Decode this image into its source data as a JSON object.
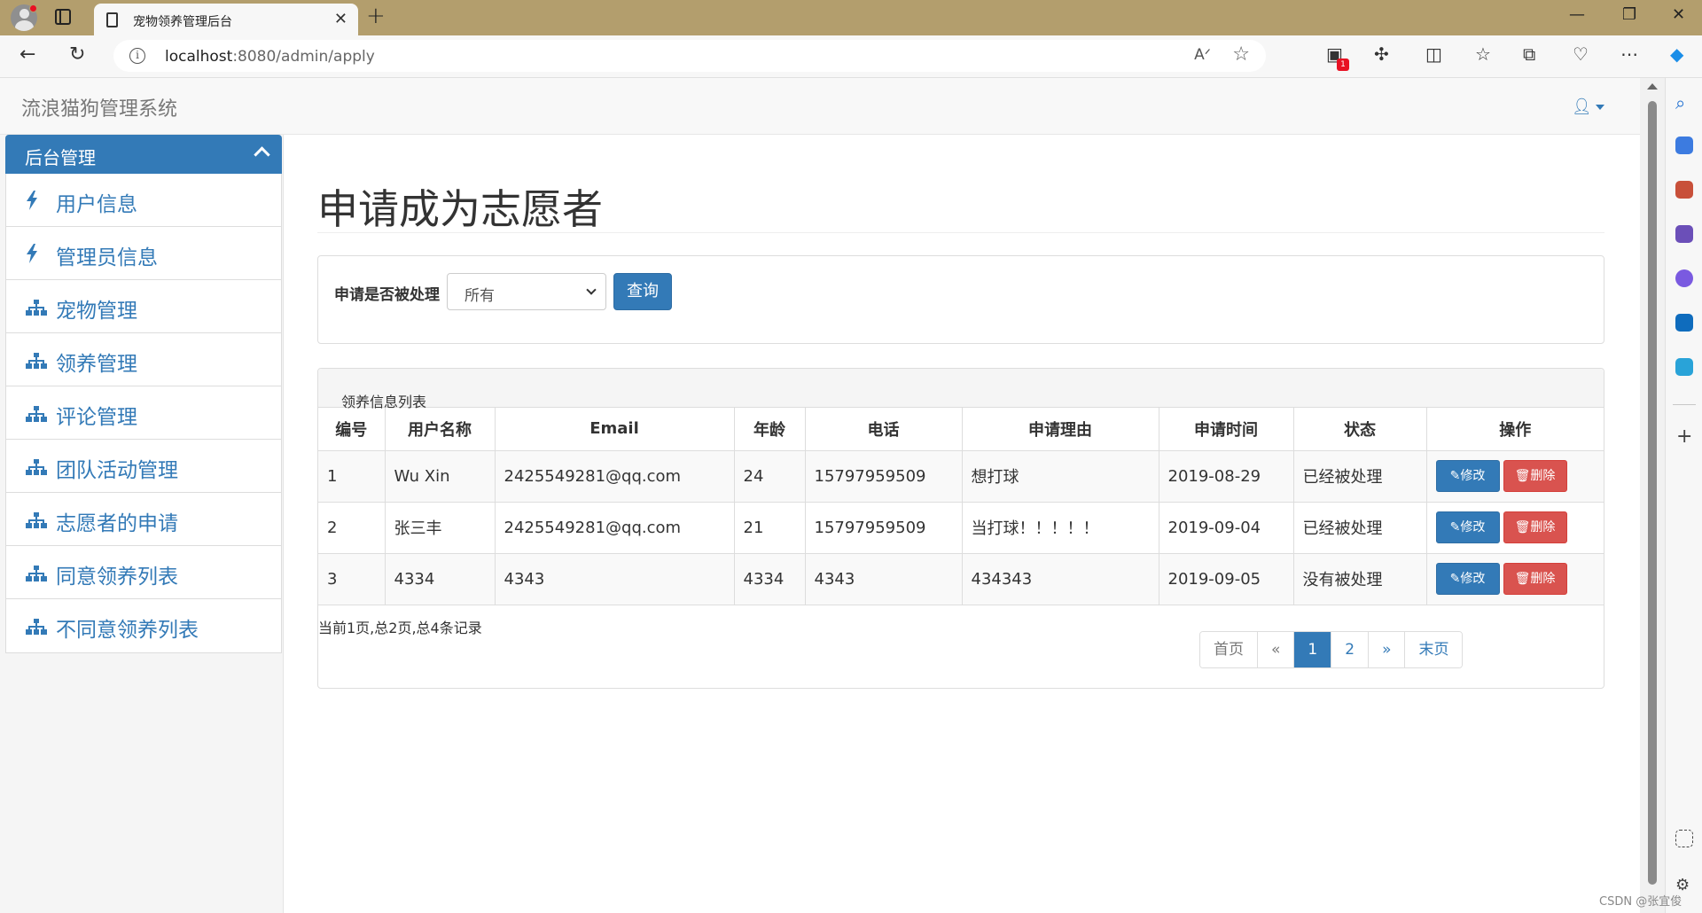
{
  "browser": {
    "tab_title": "宠物领养管理后台",
    "url_host": "localhost",
    "url_rest": ":8080/admin/apply",
    "extension_badge": "1"
  },
  "app": {
    "brand": "流浪猫狗管理系统"
  },
  "sidebar": {
    "header": "后台管理",
    "items": [
      {
        "label": "用户信息",
        "icon": "bolt-icon"
      },
      {
        "label": "管理员信息",
        "icon": "bolt-icon"
      },
      {
        "label": "宠物管理",
        "icon": "sitemap-icon"
      },
      {
        "label": "领养管理",
        "icon": "sitemap-icon"
      },
      {
        "label": "评论管理",
        "icon": "sitemap-icon"
      },
      {
        "label": "团队活动管理",
        "icon": "sitemap-icon"
      },
      {
        "label": "志愿者的申请",
        "icon": "sitemap-icon"
      },
      {
        "label": "同意领养列表",
        "icon": "sitemap-icon"
      },
      {
        "label": "不同意领养列表",
        "icon": "sitemap-icon"
      }
    ]
  },
  "main": {
    "page_title": "申请成为志愿者",
    "filter": {
      "label": "申请是否被处理",
      "selected": "所有",
      "query_button": "查询"
    },
    "list": {
      "title": "领养信息列表",
      "columns": [
        "编号",
        "用户名称",
        "Email",
        "年龄",
        "电话",
        "申请理由",
        "申请时间",
        "状态",
        "操作"
      ],
      "rows": [
        [
          "1",
          "Wu Xin",
          "2425549281@qq.com",
          "24",
          "15797959509",
          "想打球",
          "2019-08-29",
          "已经被处理"
        ],
        [
          "2",
          "张三丰",
          "2425549281@qq.com",
          "21",
          "15797959509",
          "当打球！！！！！",
          "2019-09-04",
          "已经被处理"
        ],
        [
          "3",
          "4334",
          "4343",
          "4334",
          "4343",
          "434343",
          "2019-09-05",
          "没有被处理"
        ]
      ],
      "edit_label": "修改",
      "delete_label": "删除",
      "info": "当前1页,总2页,总4条记录"
    },
    "pagination": {
      "first": "首页",
      "prev": "«",
      "pages": [
        "1",
        "2"
      ],
      "next": "»",
      "last": "末页",
      "current": "1"
    }
  },
  "watermark": "CSDN @张宜俊",
  "colors": {
    "primary": "#337ab7",
    "danger": "#d9534f",
    "titlebar": "#b39e6d"
  }
}
